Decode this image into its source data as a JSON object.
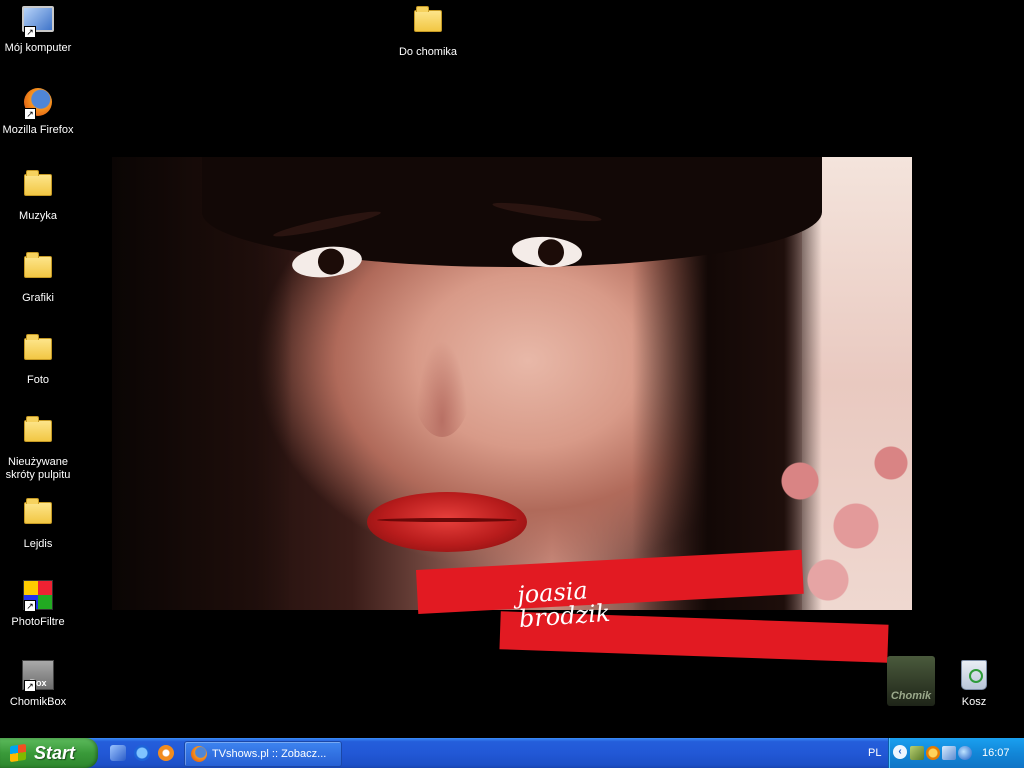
{
  "desktop": {
    "icons": [
      {
        "label": "Mój komputer",
        "icon": "my-computer-icon"
      },
      {
        "label": "Do chomika",
        "icon": "folder-icon"
      },
      {
        "label": "Mozilla Firefox",
        "icon": "firefox-icon"
      },
      {
        "label": "Muzyka",
        "icon": "folder-icon"
      },
      {
        "label": "Grafiki",
        "icon": "folder-icon"
      },
      {
        "label": "Foto",
        "icon": "folder-icon"
      },
      {
        "label": "Nieużywane skróty pulpitu",
        "icon": "folder-icon"
      },
      {
        "label": "Lejdis",
        "icon": "folder-icon"
      },
      {
        "label": "PhotoFiltre",
        "icon": "photofiltre-icon"
      },
      {
        "label": "ChomikBox",
        "icon": "chomikbox-icon"
      },
      {
        "label": "Kosz",
        "icon": "recycle-bin-icon"
      }
    ],
    "wallpaper": {
      "signature_line1": "joasia",
      "signature_line2": "brodzik",
      "logo_text": "Chomik"
    },
    "chomikbox_badge": "Box"
  },
  "taskbar": {
    "start_label": "Start",
    "quick_launch": [
      "show-desktop-icon",
      "internet-explorer-icon",
      "media-player-icon"
    ],
    "tasks": [
      {
        "title": "TVshows.pl :: Zobacz...",
        "icon": "firefox-icon"
      }
    ],
    "language": "PL",
    "tray_icons": [
      "chomikbox-tray-icon",
      "sun-tray-icon",
      "network-tray-icon",
      "globe-tray-icon"
    ],
    "clock": "16:07"
  },
  "colors": {
    "taskbar_blue": "#245edb",
    "start_green": "#3a9a3a",
    "banner_red": "#e21a22"
  }
}
